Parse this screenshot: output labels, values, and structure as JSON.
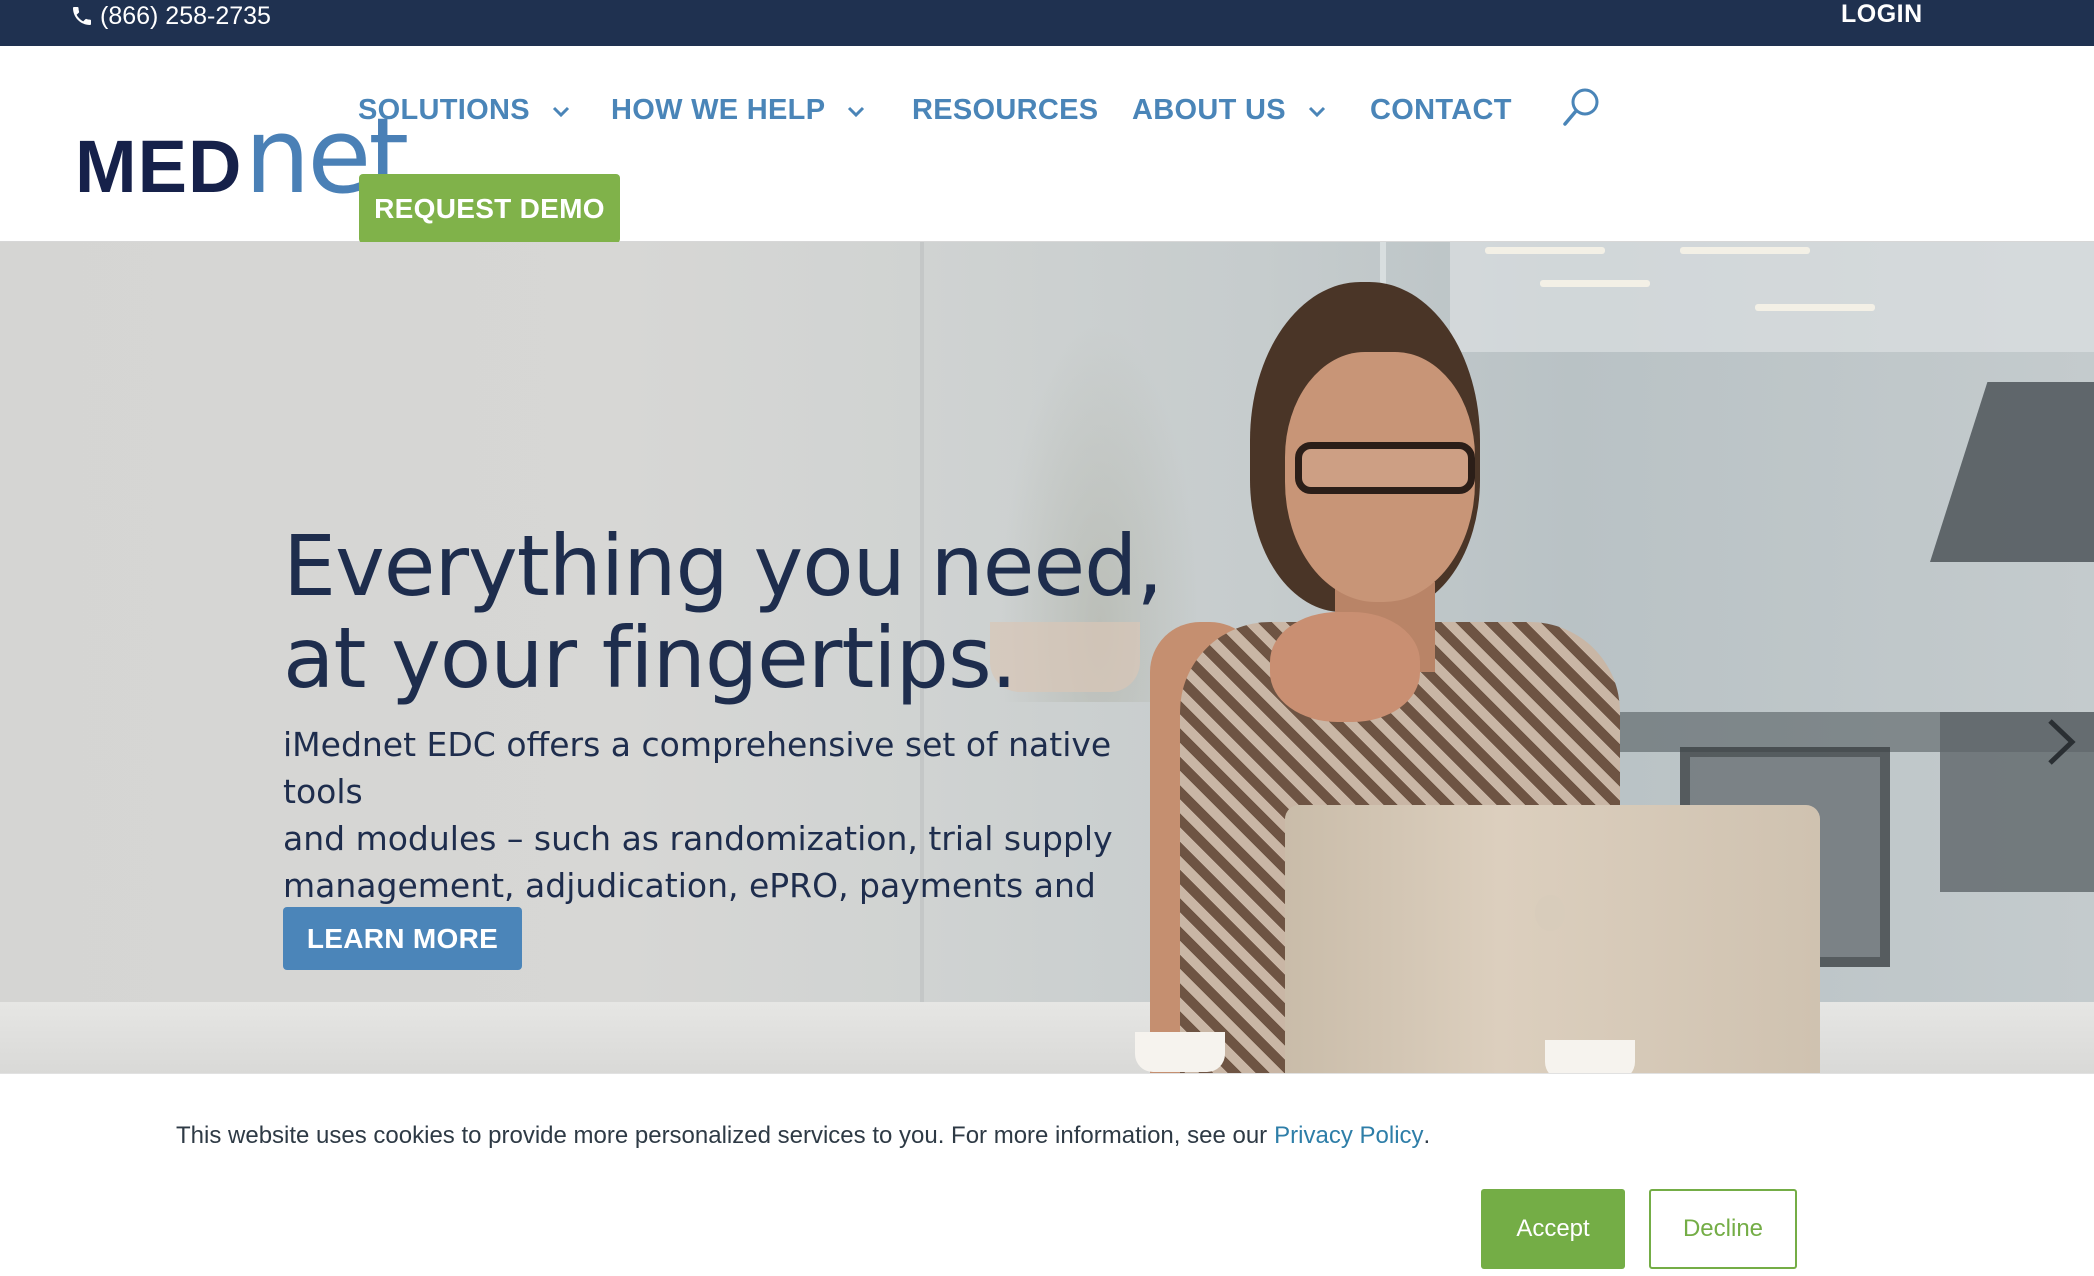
{
  "topbar": {
    "phone": "(866) 258-2735",
    "phone_icon": "phone-icon",
    "login": "LOGIN"
  },
  "header": {
    "logo": {
      "part1": "MED",
      "part2": "net"
    },
    "nav": [
      {
        "label": "SOLUTIONS",
        "has_dropdown": true
      },
      {
        "label": "HOW WE HELP",
        "has_dropdown": true
      },
      {
        "label": "RESOURCES",
        "has_dropdown": false
      },
      {
        "label": "ABOUT US",
        "has_dropdown": true
      },
      {
        "label": "CONTACT",
        "has_dropdown": false
      }
    ],
    "search_icon": "search-icon",
    "cta": "REQUEST DEMO"
  },
  "hero": {
    "title_line1": "Everything you need,",
    "title_line2": "at your fingertips.",
    "desc_line1": "iMednet EDC offers a comprehensive set of native tools",
    "desc_line2": "and modules – such as randomization, trial supply",
    "desc_line3": "management, adjudication, ePRO, payments and more.",
    "button": "LEARN MORE",
    "next_icon": "chevron-right-icon"
  },
  "cookie": {
    "text": "This website uses cookies to provide more personalized services to you. For more information, see our",
    "link": "Privacy Policy",
    "period": ".",
    "accept": "Accept",
    "decline": "Decline"
  },
  "colors": {
    "topbar_bg": "#1f3150",
    "nav_text": "#4a85b8",
    "logo_dark": "#16214a",
    "logo_light": "#4a80b6",
    "demo_green": "#80b24a",
    "learn_blue": "#4b85b9",
    "hero_text": "#1e2d4d",
    "cookie_green": "#74ad46",
    "link_blue": "#2e7ea8"
  }
}
